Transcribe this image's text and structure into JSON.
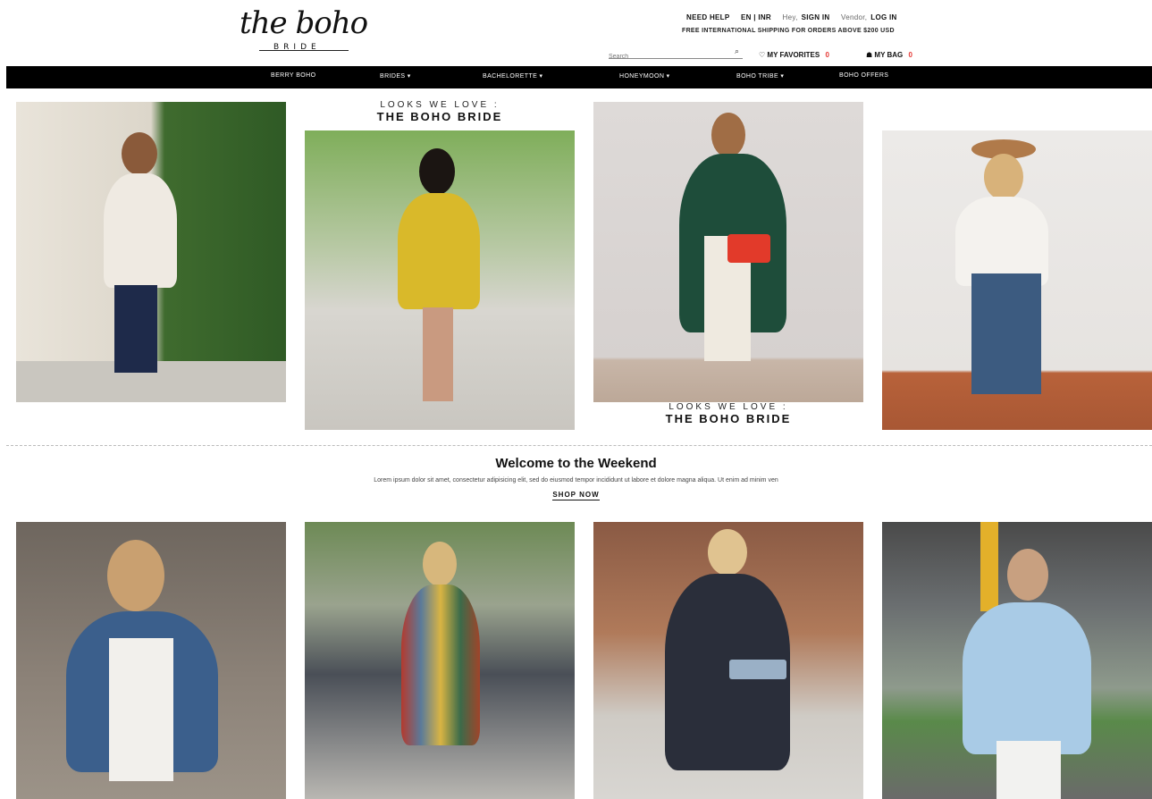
{
  "header": {
    "logo_script": "the boho",
    "logo_sub": "BRIDE",
    "need_help": "NEED HELP",
    "language_currency": "EN | INR",
    "greeting": "Hey,",
    "sign_in": "SIGN IN",
    "vendor": "Vendor,",
    "log_in": "LOG IN",
    "shipping_notice": "FREE INTERNATIONAL SHIPPING FOR ORDERS ABOVE $200 USD",
    "search_placeholder": "Search",
    "favorites_label": "MY FAVORITES",
    "favorites_count": "0",
    "bag_label": "MY BAG",
    "bag_count": "0"
  },
  "nav": {
    "items": [
      {
        "label": "BERRY BOHO"
      },
      {
        "label": "BRIDES ▾"
      },
      {
        "label": "BACHELORETTE ▾"
      },
      {
        "label": "HONEYMOON ▾"
      },
      {
        "label": "BOHO TRIBE ▾"
      },
      {
        "label": "BOHO OFFERS"
      }
    ]
  },
  "lookbook": {
    "caption_top_small": "LOOKS WE LOVE :",
    "caption_top_big": "THE BOHO BRIDE",
    "caption_bottom_small": "LOOKS WE LOVE :",
    "caption_bottom_big": "THE BOHO BRIDE"
  },
  "welcome": {
    "title": "Welcome to the Weekend",
    "text": "Lorem ipsum dolor sit amet, consectetur adipisicing elit, sed do eiusmod tempor incididunt ut labore et dolore magna aliqua. Ut enim ad minim ven",
    "cta": "SHOP NOW"
  },
  "colors": {
    "nav_bg": "#000000",
    "accent_count": "#e53935"
  }
}
